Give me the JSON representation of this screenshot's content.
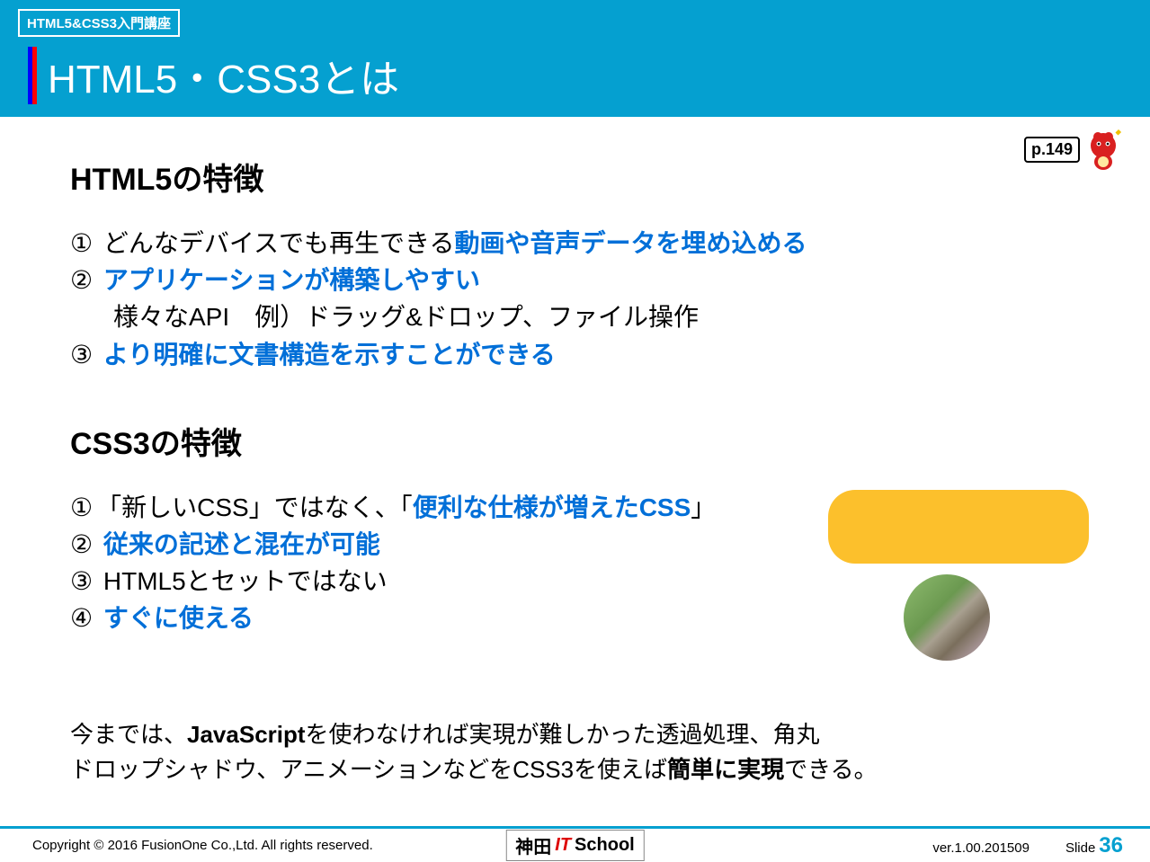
{
  "header": {
    "course_label": "HTML5&CSS3入門講座",
    "slide_title": "HTML5・CSS3とは"
  },
  "page_badge": "p.149",
  "html5": {
    "title": "HTML5の特徴",
    "item1_num": "①",
    "item1_text": "どんなデバイスでも再生できる",
    "item1_blue": "動画や音声データを埋め込める",
    "item2_num": "②",
    "item2_blue": "アプリケーションが構築しやすい",
    "item2_sub": "様々なAPI　例）ドラッグ&ドロップ、ファイル操作",
    "item3_num": "③",
    "item3_blue": "より明確に文書構造を示すことができる"
  },
  "css3": {
    "title": "CSS3の特徴",
    "item1_num": "①",
    "item1_pre": "「新しいCSS」ではなく、「",
    "item1_blue": "便利な仕様が増えたCSS",
    "item1_post": "」",
    "item2_num": "②",
    "item2_blue": "従来の記述と混在が可能",
    "item3_num": "③",
    "item3_text": "HTML5とセットではない",
    "item4_num": "④",
    "item4_blue": "すぐに使える"
  },
  "summary": {
    "line1_pre": "今までは、",
    "line1_bold": "JavaScript",
    "line1_post": "を使わなければ実現が難しかった透過処理、角丸",
    "line2_pre": "ドロップシャドウ、アニメーションなどをCSS3を使えば",
    "line2_bold": "簡単に実現",
    "line2_post": "できる。"
  },
  "footer": {
    "copyright": "Copyright © 2016 FusionOne Co.,Ltd. All rights reserved.",
    "logo_kanji": "神田",
    "logo_it": "IT",
    "logo_school": "School",
    "version": "ver.1.00.201509",
    "slide_label": "Slide",
    "slide_number": "36"
  }
}
